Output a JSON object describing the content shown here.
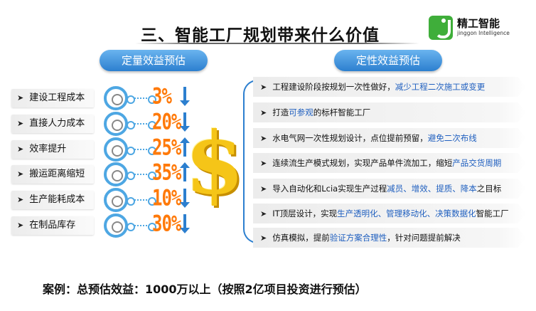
{
  "title": "三、智能工厂规划带来什么价值",
  "logo": {
    "name_cn": "精工智能",
    "name_en": "jinggon Intelligence"
  },
  "left_panel": {
    "header": "定量效益预估",
    "items": [
      {
        "label": "建设工程成本",
        "percent": "3%",
        "direction": "down"
      },
      {
        "label": "直接人力成本",
        "percent": "20%",
        "direction": "down"
      },
      {
        "label": "效率提升",
        "percent": "25%",
        "direction": "up"
      },
      {
        "label": "搬运距离缩短",
        "percent": "35%",
        "direction": "up"
      },
      {
        "label": "生产能耗成本",
        "percent": "10%",
        "direction": "down"
      },
      {
        "label": "在制品库存",
        "percent": "30%",
        "direction": "down"
      }
    ]
  },
  "right_panel": {
    "header": "定性效益预估",
    "items": [
      {
        "pre": "工程建设阶段按规划一次性做好，",
        "hl": "减少工程二次施工或变更",
        "post": ""
      },
      {
        "pre": "打造",
        "hl": "可参观",
        "post": "的标杆智能工厂"
      },
      {
        "pre": "水电气网一次性规划设计，点位提前预留，",
        "hl": "避免二次布线",
        "post": ""
      },
      {
        "pre": "连续流生产模式规划，实现产品单件流加工，缩短",
        "hl": "产品交货周期",
        "post": ""
      },
      {
        "pre": "导入自动化和Lcia实现生产过程",
        "hl": "减员、增效、提质、降本",
        "post": "之目标"
      },
      {
        "pre": "IT顶层设计，实现",
        "hl": "生产透明化、管理移动化、决策数据化",
        "post": "智能工厂"
      },
      {
        "pre": "仿真模拟，提前",
        "hl": "验证方案合理性",
        "post": "，针对问题提前解决"
      }
    ]
  },
  "case_text": "案例：总预估效益：1000万以上（按照2亿项目投资进行预估）",
  "colors": {
    "accent_blue": "#2c7fcf",
    "percent_orange": "#ff7a0a",
    "dollar_gold": "#f5c518",
    "highlight_blue": "#1f5fbf"
  },
  "icons": {
    "bullet": "arrow-right-icon",
    "gauge": "gauge-icon",
    "money": "dollar-sign-icon"
  }
}
